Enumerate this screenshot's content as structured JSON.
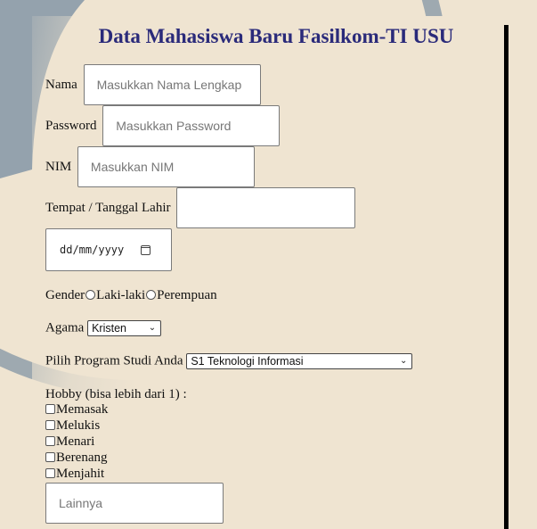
{
  "form": {
    "title": "Data Mahasiswa Baru Fasilkom-TI USU",
    "name_label": "Nama",
    "name_placeholder": "Masukkan Nama Lengkap",
    "password_label": "Password",
    "password_placeholder": "Masukkan Password",
    "nim_label": "NIM",
    "nim_placeholder": "Masukkan NIM",
    "birth_label": "Tempat / Tanggal Lahir",
    "birth_place_value": "",
    "date_value": "dd/mm/yyyy",
    "gender_label": "Gender",
    "gender_options": [
      "Laki-laki",
      "Perempuan"
    ],
    "religion_label": "Agama",
    "religion_selected": "Kristen",
    "program_label": "Pilih Program Studi Anda",
    "program_selected": "S1 Teknologi Informasi",
    "hobby_label": "Hobby (bisa lebih dari 1) :",
    "hobbies": [
      "Memasak",
      "Melukis",
      "Menari",
      "Berenang",
      "Menjahit"
    ],
    "other_placeholder": "Lainnya"
  },
  "colors": {
    "background": "#efe4d1",
    "title": "#2a2a7a",
    "background_circle": "#8a9aa8"
  },
  "icons": {
    "date_picker": "calendar-icon",
    "select": "chevron-down-icon"
  }
}
